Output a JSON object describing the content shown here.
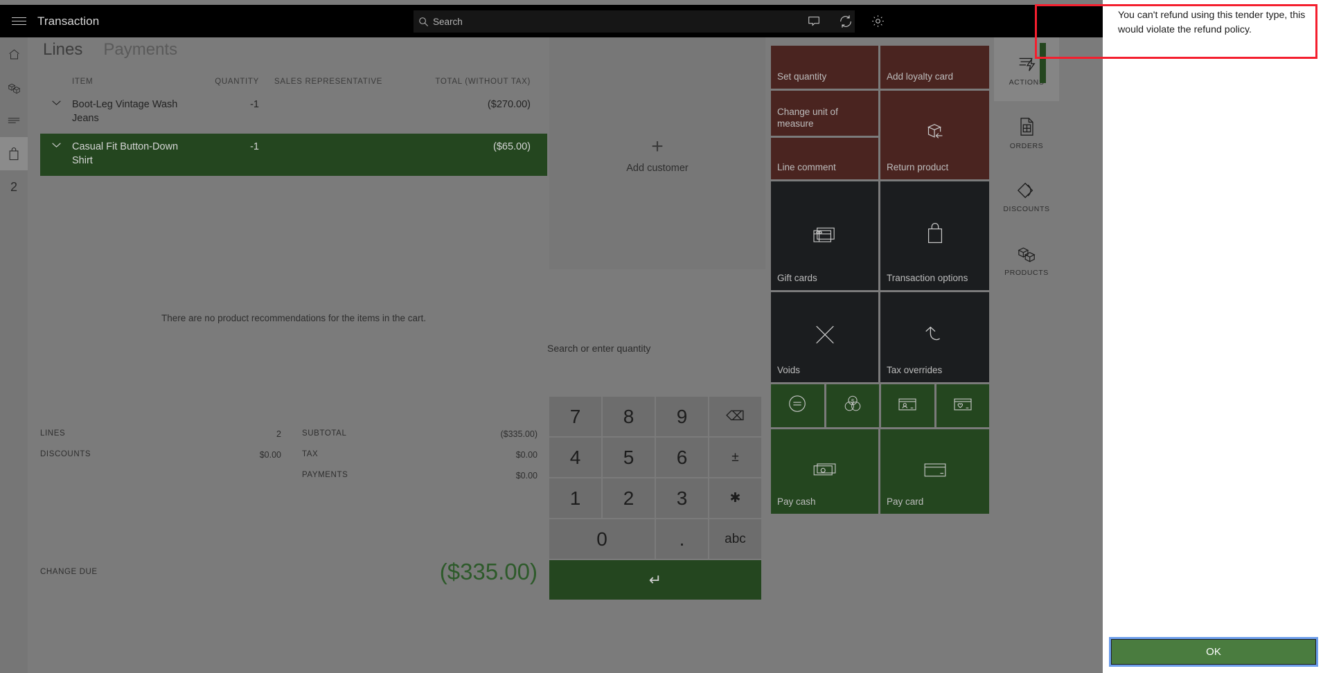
{
  "topbar": {
    "title": "Transaction",
    "search_placeholder": "Search",
    "menu_icon": "hamburger-icon",
    "icons": [
      "chat-bubble-icon",
      "sync-refresh-icon",
      "settings-gear-icon"
    ]
  },
  "left_rail": {
    "items": [
      {
        "icon": "home-icon",
        "active": false
      },
      {
        "icon": "products-boxes-icon",
        "active": false
      },
      {
        "icon": "list-lines-icon",
        "active": false
      },
      {
        "icon": "shopping-bag-icon",
        "active": true
      }
    ],
    "count_badge": "2"
  },
  "tabs": [
    {
      "label": "Lines",
      "active": true
    },
    {
      "label": "Payments",
      "active": false
    }
  ],
  "cart": {
    "columns": {
      "item": "ITEM",
      "quantity": "QUANTITY",
      "sales_representative": "SALES REPRESENTATIVE",
      "total": "TOTAL (WITHOUT TAX)"
    },
    "rows": [
      {
        "item": "Boot-Leg Vintage Wash Jeans",
        "quantity": "-1",
        "sales_representative": "",
        "total": "($270.00)",
        "selected": false
      },
      {
        "item": "Casual Fit Button-Down Shirt",
        "quantity": "-1",
        "sales_representative": "",
        "total": "($65.00)",
        "selected": true
      }
    ],
    "empty_recommendations": "There are no product recommendations for the items in the cart."
  },
  "totals": {
    "lines_label": "LINES",
    "lines_value": "2",
    "discounts_label": "DISCOUNTS",
    "discounts_value": "$0.00",
    "subtotal_label": "SUBTOTAL",
    "subtotal_value": "($335.00)",
    "tax_label": "TAX",
    "tax_value": "$0.00",
    "payments_label": "PAYMENTS",
    "payments_value": "$0.00",
    "change_due_label": "CHANGE DUE",
    "change_due_value": "($335.00)",
    "change_due_color": "#2d5a2a"
  },
  "customer": {
    "add_label": "Add customer",
    "plus_icon": "plus-icon"
  },
  "quantity_search_placeholder": "Search or enter quantity",
  "keypad": {
    "keys": [
      {
        "label": "7",
        "name": "key-7"
      },
      {
        "label": "8",
        "name": "key-8"
      },
      {
        "label": "9",
        "name": "key-9"
      },
      {
        "label": "⌫",
        "name": "backspace-key"
      },
      {
        "label": "4",
        "name": "key-4"
      },
      {
        "label": "5",
        "name": "key-5"
      },
      {
        "label": "6",
        "name": "key-6"
      },
      {
        "label": "±",
        "name": "plus-minus-key"
      },
      {
        "label": "1",
        "name": "key-1"
      },
      {
        "label": "2",
        "name": "key-2"
      },
      {
        "label": "3",
        "name": "key-3"
      },
      {
        "label": "✱",
        "name": "asterisk-key"
      },
      {
        "label": "0",
        "name": "key-0"
      },
      {
        "label": ".",
        "name": "decimal-key"
      },
      {
        "label": "abc",
        "name": "abc-key"
      }
    ],
    "enter_label": "↵"
  },
  "tiles": {
    "row1": [
      {
        "label": "Set quantity",
        "color": "maroon",
        "icon": ""
      },
      {
        "label": "Add loyalty card",
        "color": "maroon",
        "icon": ""
      }
    ],
    "row2": [
      {
        "label": "Change unit of measure",
        "color": "maroon",
        "icon": ""
      },
      {
        "label": "Return product",
        "color": "maroon",
        "icon": "return-box-icon"
      }
    ],
    "row3": [
      {
        "label": "Line comment",
        "color": "maroon",
        "icon": ""
      }
    ],
    "row4": [
      {
        "label": "Gift cards",
        "color": "dark",
        "icon": "gift-card-icon"
      },
      {
        "label": "Transaction options",
        "color": "dark",
        "icon": "shopping-bag-icon"
      }
    ],
    "row5": [
      {
        "label": "Voids",
        "color": "dark",
        "icon": "close-x-icon"
      },
      {
        "label": "Tax overrides",
        "color": "dark",
        "icon": "undo-arrow-icon"
      }
    ],
    "row6": [
      {
        "label": "",
        "color": "green",
        "icon": "equals-circle-icon"
      },
      {
        "label": "",
        "color": "green",
        "icon": "currency-coins-icon"
      },
      {
        "label": "",
        "color": "green",
        "icon": "customer-card-icon"
      },
      {
        "label": "",
        "color": "green",
        "icon": "loyalty-heart-card-icon"
      }
    ],
    "row7": [
      {
        "label": "Pay cash",
        "color": "green",
        "icon": "cash-bills-icon"
      },
      {
        "label": "Pay card",
        "color": "green",
        "icon": "credit-card-icon"
      }
    ]
  },
  "right_rail": [
    {
      "label": "ACTIONS",
      "icon": "actions-lightning-icon",
      "active": true
    },
    {
      "label": "ORDERS",
      "icon": "orders-document-icon",
      "active": false
    },
    {
      "label": "DISCOUNTS",
      "icon": "discount-tag-icon",
      "active": false
    },
    {
      "label": "PRODUCTS",
      "icon": "products-cubes-icon",
      "active": false
    }
  ],
  "dialog": {
    "message": "You can't refund using this tender type, this would violate the refund policy.",
    "ok_label": "OK",
    "ok_color": "#4a7c3f"
  },
  "annotation": {
    "color": "#f41f2e"
  }
}
